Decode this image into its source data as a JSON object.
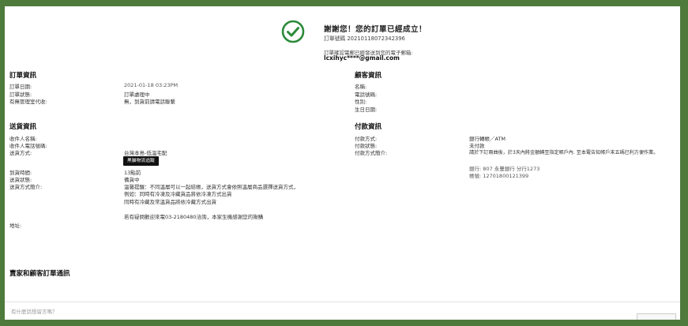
{
  "success": {
    "title": "謝謝您！您的訂單已經成立！",
    "order_number": "訂單號碼 20210118072342396",
    "email_note": "訂單確認電郵已經發送到您的電子郵箱:",
    "email": "lcxihyc****@gmail.com",
    "check_color": "#2c8a3a"
  },
  "order_info": {
    "title": "訂單資訊",
    "rows": [
      {
        "label": "訂單日期:",
        "value": "2021-01-18 03:23PM"
      },
      {
        "label": "訂單狀態:",
        "value": "訂單處理中"
      },
      {
        "label": "有無管理室代收:",
        "value": "無，到貨前請電話聯繫"
      }
    ]
  },
  "customer_info": {
    "title": "顧客資訊",
    "rows": [
      {
        "label": "名稱:"
      },
      {
        "label": "電話號碼:"
      },
      {
        "label": "性別:"
      },
      {
        "label": "生日日期:"
      }
    ]
  },
  "shipping_info": {
    "title": "送貨資訊",
    "recipient_name_label": "收件人名稱:",
    "recipient_phone_label": "收件人電話號碼:",
    "method_label": "送貨方式:",
    "method_value": "台灣本島-低溫宅配",
    "tracking_button": "黑貓物流追蹤",
    "arrival_label": "到貨時間:",
    "arrival_value": "13點前",
    "status_label": "送貨狀態:",
    "status_value": "備貨中",
    "desc_label": "送貨方式簡介:",
    "desc_lines": [
      "溫馨提醒：不同溫層可以一起結帳，送貨方式會依照溫層商品選擇送貨方式，",
      "例如：同時有冷凍及冷藏貨品將依冷凍方式出貨",
      "同時有冷藏及常溫貨品將依冷藏方式出貨"
    ],
    "contact_line": "若有疑問歡迎來電03-2180480洽詢，本家生機感謝您的揪購",
    "address_label": "地址:"
  },
  "payment_info": {
    "title": "付款資訊",
    "method_label": "付款方式:",
    "method_value": "銀行轉帳／ATM",
    "status_label": "付款狀態:",
    "status_value": "未付款",
    "desc_label": "付款方式簡介:",
    "desc_line": "請於下訂兩曲後，於3天內將金額轉至指定帳戶內. 至本電告知帳戶末五碼已利方便作業。",
    "bank_line": "銀行: 807 永豐銀行 分行1273",
    "account_line": "帳號: 12701800121399"
  },
  "communication": {
    "title": "賣家和顧客訂單通訊",
    "placeholder": "有什麼話想留言嗎？"
  }
}
